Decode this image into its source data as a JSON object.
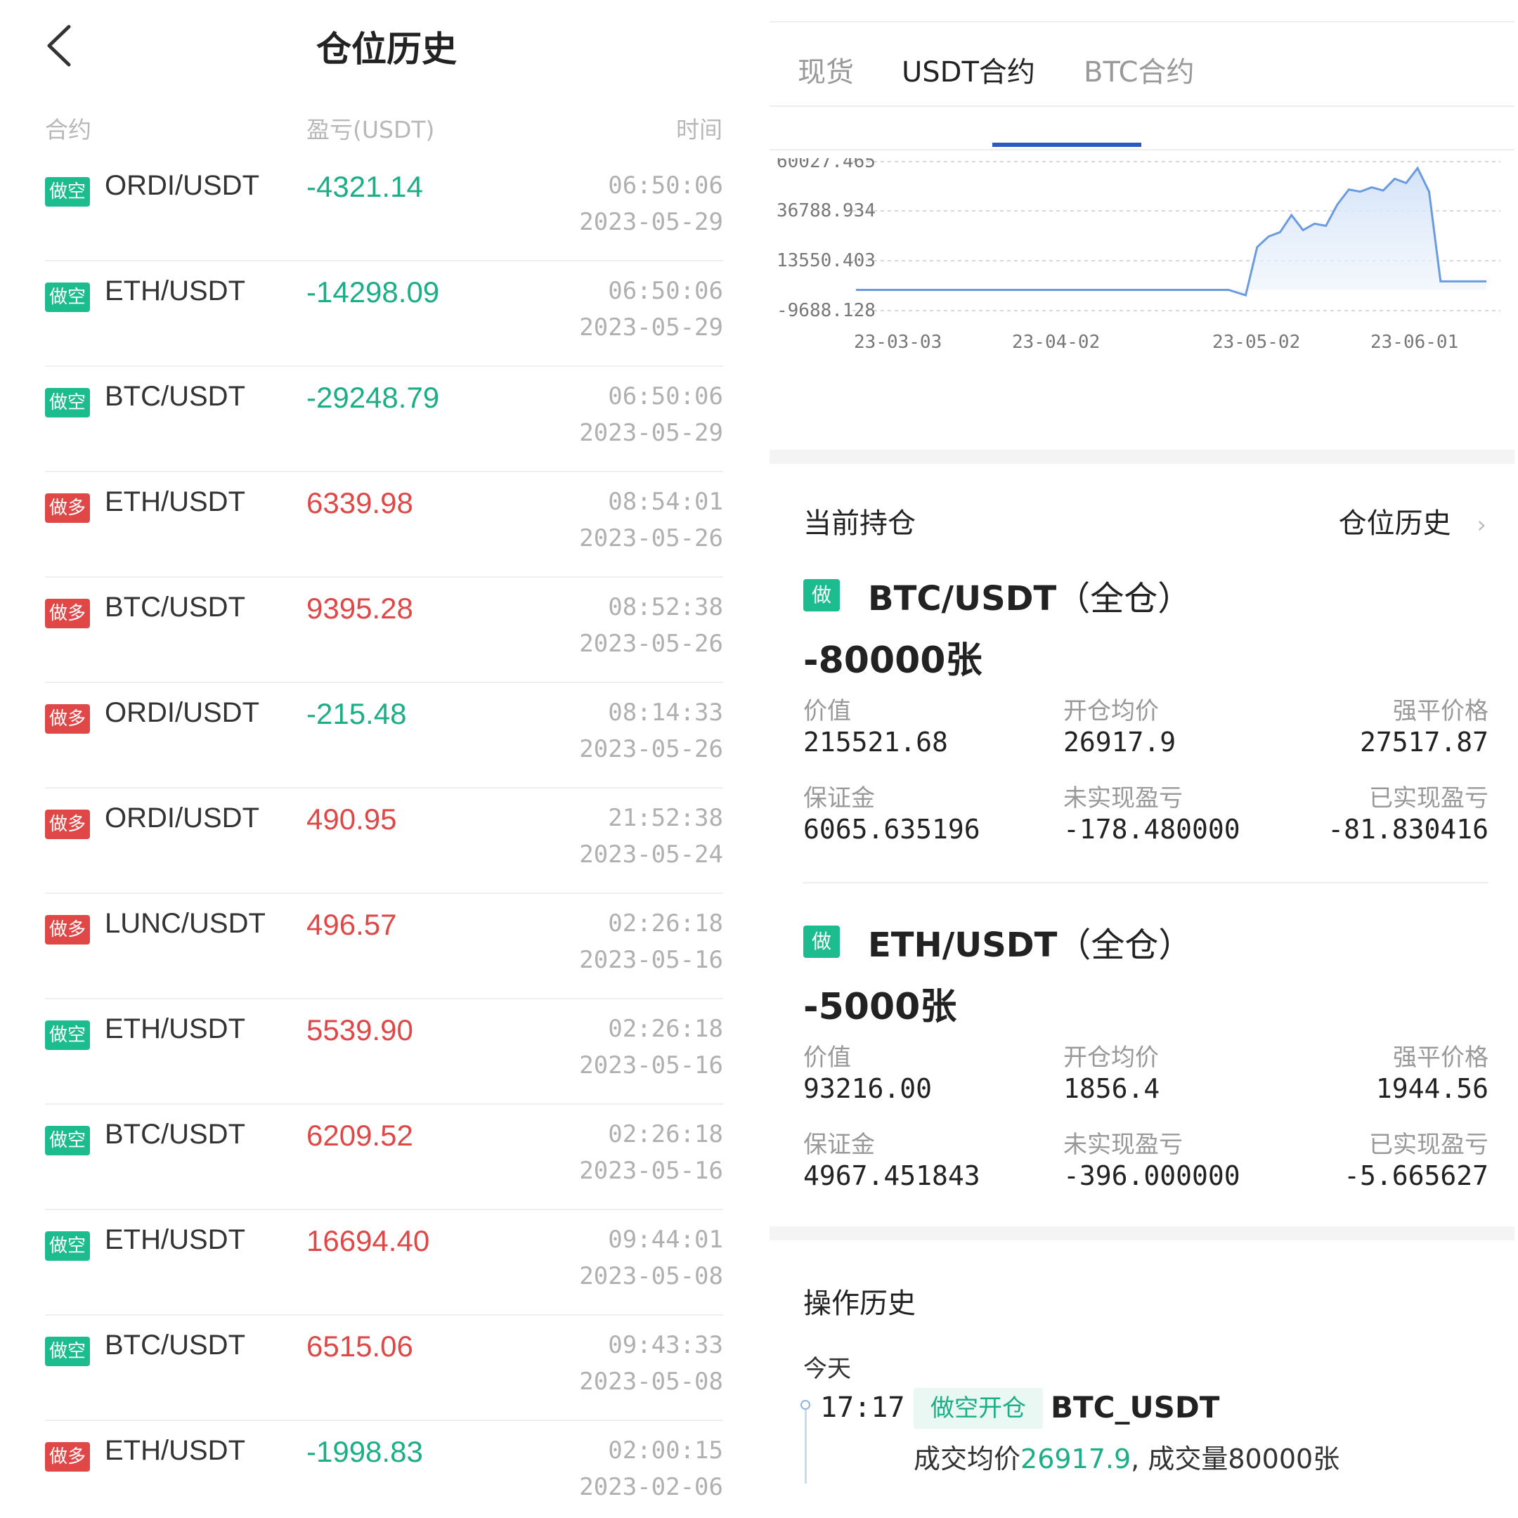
{
  "left": {
    "title": "仓位历史",
    "columns": {
      "contract": "合约",
      "pnl": "盈亏(USDT)",
      "time": "时间"
    },
    "rows": [
      {
        "side": "做空",
        "side_type": "short",
        "pair": "ORDI/USDT",
        "pnl": "-4321.14",
        "pnl_sign": "neg",
        "time": "06:50:06",
        "date": "2023-05-29"
      },
      {
        "side": "做空",
        "side_type": "short",
        "pair": "ETH/USDT",
        "pnl": "-14298.09",
        "pnl_sign": "neg",
        "time": "06:50:06",
        "date": "2023-05-29"
      },
      {
        "side": "做空",
        "side_type": "short",
        "pair": "BTC/USDT",
        "pnl": "-29248.79",
        "pnl_sign": "neg",
        "time": "06:50:06",
        "date": "2023-05-29"
      },
      {
        "side": "做多",
        "side_type": "long",
        "pair": "ETH/USDT",
        "pnl": "6339.98",
        "pnl_sign": "pos",
        "time": "08:54:01",
        "date": "2023-05-26"
      },
      {
        "side": "做多",
        "side_type": "long",
        "pair": "BTC/USDT",
        "pnl": "9395.28",
        "pnl_sign": "pos",
        "time": "08:52:38",
        "date": "2023-05-26"
      },
      {
        "side": "做多",
        "side_type": "long",
        "pair": "ORDI/USDT",
        "pnl": "-215.48",
        "pnl_sign": "neg",
        "time": "08:14:33",
        "date": "2023-05-26"
      },
      {
        "side": "做多",
        "side_type": "long",
        "pair": "ORDI/USDT",
        "pnl": "490.95",
        "pnl_sign": "pos",
        "time": "21:52:38",
        "date": "2023-05-24"
      },
      {
        "side": "做多",
        "side_type": "long",
        "pair": "LUNC/USDT",
        "pnl": "496.57",
        "pnl_sign": "pos",
        "time": "02:26:18",
        "date": "2023-05-16"
      },
      {
        "side": "做空",
        "side_type": "short",
        "pair": "ETH/USDT",
        "pnl": "5539.90",
        "pnl_sign": "pos",
        "time": "02:26:18",
        "date": "2023-05-16"
      },
      {
        "side": "做空",
        "side_type": "short",
        "pair": "BTC/USDT",
        "pnl": "6209.52",
        "pnl_sign": "pos",
        "time": "02:26:18",
        "date": "2023-05-16"
      },
      {
        "side": "做空",
        "side_type": "short",
        "pair": "ETH/USDT",
        "pnl": "16694.40",
        "pnl_sign": "pos",
        "time": "09:44:01",
        "date": "2023-05-08"
      },
      {
        "side": "做空",
        "side_type": "short",
        "pair": "BTC/USDT",
        "pnl": "6515.06",
        "pnl_sign": "pos",
        "time": "09:43:33",
        "date": "2023-05-08"
      },
      {
        "side": "做多",
        "side_type": "long",
        "pair": "ETH/USDT",
        "pnl": "-1998.83",
        "pnl_sign": "neg",
        "time": "02:00:15",
        "date": "2023-02-06"
      }
    ]
  },
  "right": {
    "tabs": [
      {
        "label": "现货",
        "active": false
      },
      {
        "label": "USDT合约",
        "active": true
      },
      {
        "label": "BTC合约",
        "active": false
      }
    ],
    "current_positions_title": "当前持仓",
    "history_link": "仓位历史",
    "positions": [
      {
        "side": "做空",
        "pair": "BTC/USDT",
        "mode": "（全仓）",
        "qty": "-80000张",
        "value_label": "价值",
        "value": "215521.68",
        "avg_label": "开仓均价",
        "avg": "26917.9",
        "liq_label": "强平价格",
        "liq": "27517.87",
        "margin_label": "保证金",
        "margin": "6065.635196",
        "unrealized_label": "未实现盈亏",
        "unrealized": "-178.480000",
        "realized_label": "已实现盈亏",
        "realized": "-81.830416"
      },
      {
        "side": "做空",
        "pair": "ETH/USDT",
        "mode": "（全仓）",
        "qty": "-5000张",
        "value_label": "价值",
        "value": "93216.00",
        "avg_label": "开仓均价",
        "avg": "1856.4",
        "liq_label": "强平价格",
        "liq": "1944.56",
        "margin_label": "保证金",
        "margin": "4967.451843",
        "unrealized_label": "未实现盈亏",
        "unrealized": "-396.000000",
        "realized_label": "已实现盈亏",
        "realized": "-5.665627"
      }
    ],
    "op_history": {
      "title": "操作历史",
      "day": "今天",
      "time": "17:17",
      "tag": "做空开仓",
      "pair": "BTC_USDT",
      "detail_prefix": "成交均价",
      "detail_price": "26917.9",
      "detail_suffix": ", 成交量80000张"
    }
  },
  "colors": {
    "short": "#1cbc8f",
    "long": "#e04848",
    "accent": "#2b59c3",
    "chart_line": "#6a9be0"
  },
  "chart_data": {
    "type": "area",
    "y_ticks": [
      "60027.465",
      "36788.934",
      "13550.403",
      "-9688.128"
    ],
    "x_ticks": [
      "23-03-03",
      "23-04-02",
      "23-05-02",
      "23-06-01"
    ],
    "ylim": [
      -9688.128,
      60027.465
    ],
    "grid": true,
    "x": [
      0,
      5,
      10,
      15,
      20,
      25,
      30,
      35,
      40,
      45,
      50,
      55,
      60,
      65,
      68,
      70,
      72,
      74,
      76,
      78,
      80,
      82,
      84,
      86,
      88,
      90,
      92,
      94,
      96,
      98,
      100,
      102,
      104,
      106,
      108,
      110
    ],
    "values": [
      0,
      0,
      0,
      0,
      0,
      0,
      0,
      0,
      0,
      0,
      0,
      0,
      0,
      0,
      -2500,
      20000,
      25000,
      27000,
      35000,
      28000,
      31000,
      30000,
      40000,
      47000,
      46000,
      48000,
      46500,
      52000,
      50000,
      57000,
      46000,
      4000,
      4000,
      4000,
      4000,
      4000
    ]
  }
}
